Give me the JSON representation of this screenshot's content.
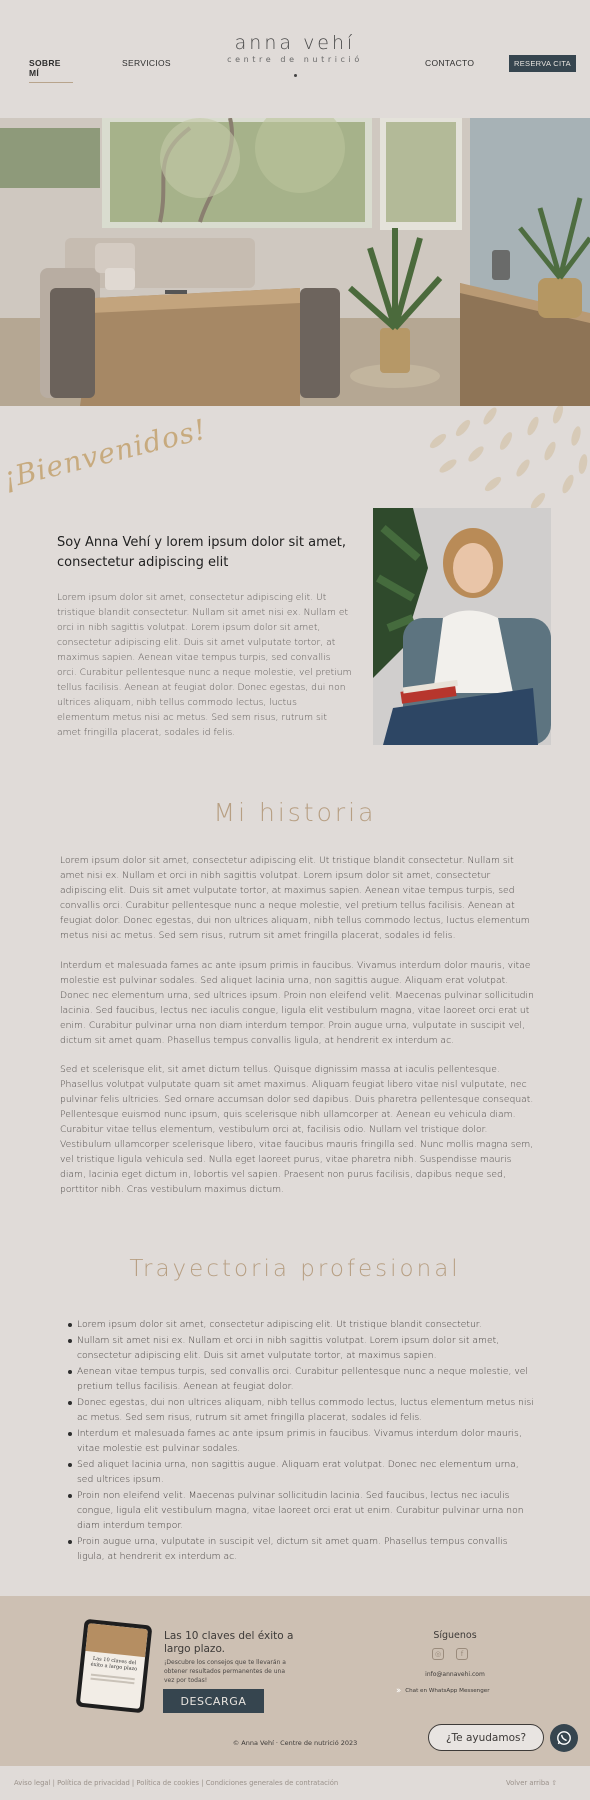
{
  "nav": {
    "sobre_mi": "SOBRE MÍ",
    "servicios": "SERVICIOS",
    "contacto": "CONTACTO",
    "reserva": "RESERVA CITA"
  },
  "brand": {
    "name": "anna vehí",
    "subtitle": "centre de nutrició"
  },
  "welcome": "¡Bienvenidos!",
  "intro": {
    "title": "Soy Anna Vehí y lorem ipsum dolor sit amet, consectetur adipiscing elit",
    "text": "Lorem ipsum dolor sit amet, consectetur adipiscing elit. Ut tristique blandit consectetur. Nullam sit amet nisi ex. Nullam et orci in nibh sagittis volutpat. Lorem ipsum dolor sit amet, consectetur adipiscing elit. Duis sit amet vulputate tortor, at maximus sapien. Aenean vitae tempus turpis, sed convallis orci. Curabitur pellentesque nunc a neque molestie, vel pretium tellus facilisis. Aenean at feugiat dolor. Donec egestas, dui non ultrices aliquam, nibh tellus commodo lectus, luctus elementum metus nisi ac metus. Sed sem risus, rutrum sit amet fringilla placerat, sodales id felis."
  },
  "historia": {
    "title": "Mi historia",
    "p1": "Lorem ipsum dolor sit amet, consectetur adipiscing elit. Ut tristique blandit consectetur. Nullam sit amet nisi ex. Nullam et orci in nibh sagittis volutpat. Lorem ipsum dolor sit amet, consectetur adipiscing elit. Duis sit amet vulputate tortor, at maximus sapien. Aenean vitae tempus turpis, sed convallis orci. Curabitur pellentesque nunc a neque molestie, vel pretium tellus facilisis. Aenean at feugiat dolor. Donec egestas, dui non ultrices aliquam, nibh tellus commodo lectus, luctus elementum metus nisi ac metus. Sed sem risus, rutrum sit amet fringilla placerat, sodales id felis.",
    "p2": "Interdum et malesuada fames ac ante ipsum primis in faucibus. Vivamus interdum dolor mauris, vitae molestie est pulvinar sodales. Sed aliquet lacinia urna, non sagittis augue. Aliquam erat volutpat. Donec nec elementum urna, sed ultrices ipsum. Proin non eleifend velit. Maecenas pulvinar sollicitudin lacinia. Sed faucibus, lectus nec iaculis congue, ligula elit vestibulum magna, vitae laoreet orci erat ut enim. Curabitur pulvinar urna non diam interdum tempor. Proin augue urna, vulputate in suscipit vel, dictum sit amet quam. Phasellus tempus convallis ligula, at hendrerit ex interdum ac.",
    "p3": "Sed et scelerisque elit, sit amet dictum tellus. Quisque dignissim massa at iaculis pellentesque. Phasellus volutpat vulputate quam sit amet maximus. Aliquam feugiat libero vitae nisl vulputate, nec pulvinar felis ultricies. Sed ornare accumsan dolor sed dapibus. Duis pharetra pellentesque consequat. Pellentesque euismod nunc ipsum, quis scelerisque nibh ullamcorper at. Aenean eu vehicula diam. Curabitur vitae tellus elementum, vestibulum orci at, facilisis odio. Nullam vel tristique dolor. Vestibulum ullamcorper scelerisque libero, vitae faucibus mauris fringilla sed. Nunc mollis magna sem, vel tristique ligula vehicula sed. Nulla eget laoreet purus, vitae pharetra nibh. Suspendisse mauris diam, lacinia eget dictum in, lobortis vel sapien. Praesent non purus facilisis, dapibus neque sed, porttitor nibh. Cras vestibulum maximus dictum."
  },
  "trayectoria": {
    "title": "Trayectoria profesional",
    "items": [
      "Lorem ipsum dolor sit amet, consectetur adipiscing elit. Ut tristique blandit consectetur.",
      "Nullam sit amet nisi ex. Nullam et orci in nibh sagittis volutpat. Lorem ipsum dolor sit amet, consectetur adipiscing elit. Duis sit amet vulputate tortor, at maximus sapien.",
      "Aenean vitae tempus turpis, sed convallis orci. Curabitur pellentesque nunc a neque molestie, vel pretium tellus facilisis. Aenean at feugiat dolor.",
      "Donec egestas, dui non ultrices aliquam, nibh tellus commodo lectus, luctus elementum metus nisi ac metus. Sed sem risus, rutrum sit amet fringilla placerat, sodales id felis.",
      "Interdum et malesuada fames ac ante ipsum primis in faucibus. Vivamus interdum dolor mauris, vitae molestie est pulvinar sodales.",
      "Sed aliquet lacinia urna, non sagittis augue. Aliquam erat volutpat. Donec nec elementum urna, sed ultrices ipsum.",
      "Proin non eleifend velit. Maecenas pulvinar sollicitudin lacinia. Sed faucibus, lectus nec iaculis congue, ligula elit vestibulum magna, vitae laoreet orci erat ut enim. Curabitur pulvinar urna non diam interdum tempor.",
      "Proin augue urna, vulputate in suscipit vel, dictum sit amet quam. Phasellus tempus convallis ligula, at hendrerit ex interdum ac."
    ]
  },
  "footer": {
    "tablet_text": "Las 10 claves del éxito a largo plazo",
    "ebook_title": "Las 10 claves del éxito a largo plazo.",
    "ebook_text": "¡Descubre los consejos que te llevarán a obtener resultados permanentes de una vez por todas!",
    "descarga": "DESCARGA",
    "siguenos": "Síguenos",
    "social_icons": [
      "instagram-icon",
      "facebook-icon"
    ],
    "email": "info@annavehi.com",
    "whatsapp_chat": "Chat en WhatsApp Messenger",
    "copyright": "© Anna Vehí · Centre de nutrició 2023",
    "help": "¿Te ayudamos?"
  },
  "bottom": {
    "aviso": "Aviso legal",
    "privacidad": "Política de privacidad",
    "cookies": "Política de cookies",
    "condiciones": "Condiciones generales de contratación",
    "sep": " | ",
    "volver": "Volver arriba"
  },
  "colors": {
    "background": "#e0dbd8",
    "accent_dark": "#36454f",
    "gold": "#b79f83",
    "footer": "#cdc0b3"
  }
}
